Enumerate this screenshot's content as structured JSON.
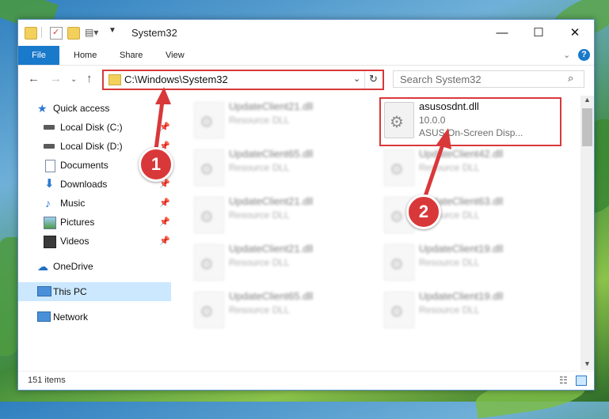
{
  "window": {
    "title": "System32"
  },
  "ribbon": {
    "tabs": [
      "File",
      "Home",
      "Share",
      "View"
    ],
    "help_label": "?"
  },
  "address_bar": {
    "path": "C:\\Windows\\System32"
  },
  "search": {
    "placeholder": "Search System32"
  },
  "sidebar": {
    "quick_access": "Quick access",
    "items": [
      {
        "label": "Local Disk (C:)",
        "icon": "drive-icon",
        "pinned": true
      },
      {
        "label": "Local Disk (D:)",
        "icon": "drive-icon",
        "pinned": true
      },
      {
        "label": "Documents",
        "icon": "documents-icon",
        "pinned": true
      },
      {
        "label": "Downloads",
        "icon": "downloads-icon",
        "pinned": true
      },
      {
        "label": "Music",
        "icon": "music-icon",
        "pinned": true
      },
      {
        "label": "Pictures",
        "icon": "pictures-icon",
        "pinned": true
      },
      {
        "label": "Videos",
        "icon": "videos-icon",
        "pinned": true
      }
    ],
    "onedrive": "OneDrive",
    "this_pc": "This PC",
    "network": "Network"
  },
  "files": {
    "highlighted": {
      "name": "asusosdnt.dll",
      "version": "10.0.0",
      "description": "ASUS On-Screen Disp..."
    },
    "left_column": [
      {
        "name": "UpdateClient21.dll",
        "type": "Resource DLL"
      },
      {
        "name": "UpdateClient65.dll",
        "type": "Resource DLL"
      },
      {
        "name": "UpdateClient21.dll",
        "type": "Resource DLL"
      },
      {
        "name": "UpdateClient21.dll",
        "type": "Resource DLL"
      },
      {
        "name": "UpdateClient65.dll",
        "type": "Resource DLL"
      }
    ],
    "right_column": [
      {
        "name": "UpdateClient42.dll",
        "type": "Resource DLL"
      },
      {
        "name": "UpdateClient63.dll",
        "type": "Resource DLL"
      },
      {
        "name": "UpdateClient19.dll",
        "type": "Resource DLL"
      },
      {
        "name": "UpdateClient19.dll",
        "type": "Resource DLL"
      }
    ]
  },
  "status": {
    "item_count": "151 items"
  },
  "annotations": {
    "step1": "1",
    "step2": "2"
  },
  "colors": {
    "accent": "#1979ca",
    "highlight": "#d9383a",
    "selection": "#cce8ff"
  }
}
